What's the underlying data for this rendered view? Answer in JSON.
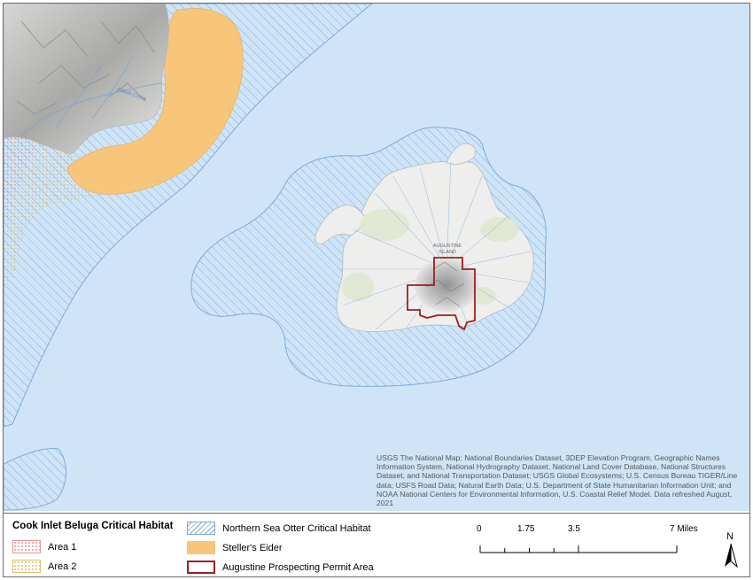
{
  "map": {
    "island_label_line1": "AUGUSTINE",
    "island_label_line2": "ISLAND",
    "creek_label": "Iniskin Creek",
    "colors": {
      "water": "#cfe5f7",
      "land": "#eeeeec",
      "otter_hatch": "#7fa9d6",
      "eider_fill": "#f7c67a",
      "beluga_area1": "#e8a0a0",
      "beluga_area2": "#e6c77a",
      "permit_outline": "#9e1e22"
    }
  },
  "attribution": "USGS The National Map: National Boundaries Dataset, 3DEP Elevation Program, Geographic Names Information System, National Hydrography Dataset, National Land Cover Database, National Structures Dataset, and National Transportation Dataset; USGS Global Ecosystems; U.S. Census Bureau TIGER/Line data; USFS Road Data; Natural Earth Data; U.S. Department of State Humanitarian Information Unit; and NOAA National Centers for Environmental Information, U.S. Coastal Relief Model. Data refreshed August, 2021",
  "legend": {
    "title": "Cook Inlet Beluga Critical Habitat",
    "area1": "Area 1",
    "area2": "Area 2",
    "otter": "Northern Sea Otter Critical Habitat",
    "eider": "Steller's Eider",
    "permit": "Augustine Prospecting Permit Area"
  },
  "scale": {
    "ticks": [
      "0",
      "1.75",
      "3.5",
      "7 Miles"
    ],
    "tick_values_miles": [
      0,
      1.75,
      3.5,
      7
    ]
  },
  "north_label": "N"
}
